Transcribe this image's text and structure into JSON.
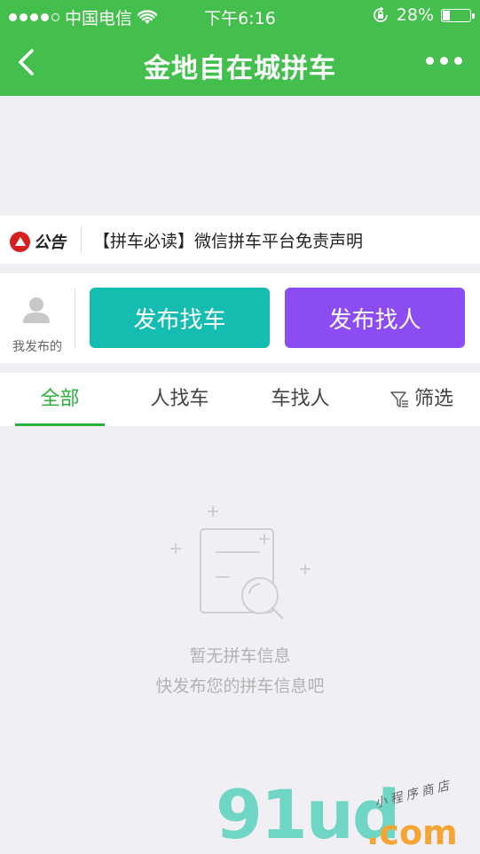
{
  "status_bar": {
    "carrier": "中国电信",
    "time": "下午6:16",
    "battery_percent": "28%",
    "battery_level": 0.28,
    "signal_icon": "signal-dots-icon",
    "wifi_icon": "wifi-icon",
    "lock_icon": "rotation-lock-icon"
  },
  "nav": {
    "title": "金地自在城拼车",
    "back_icon": "chevron-left-icon",
    "more_icon": "more-dots-icon"
  },
  "notice": {
    "logo_text": "公告",
    "text": "【拼车必读】微信拼车平台免责声明"
  },
  "actions": {
    "mine_label": "我发布的",
    "find_car_label": "发布找车",
    "find_person_label": "发布找人",
    "colors": {
      "find_car": "#14bdb0",
      "find_person": "#8c4cf4"
    }
  },
  "tabs": [
    {
      "label": "全部",
      "active": true
    },
    {
      "label": "人找车",
      "active": false
    },
    {
      "label": "车找人",
      "active": false
    },
    {
      "label": "筛选",
      "active": false,
      "icon": "filter-icon"
    }
  ],
  "empty_state": {
    "title": "暂无拼车信息",
    "subtitle": "快发布您的拼车信息吧",
    "icon": "empty-search-document-icon"
  },
  "watermark": {
    "brand": "91ud",
    "suffix": ".com",
    "tag": "小程序商店"
  },
  "colors": {
    "brand_green": "#44bf4d",
    "active_tab": "#2bb03a",
    "page_bg": "#efeff4"
  }
}
